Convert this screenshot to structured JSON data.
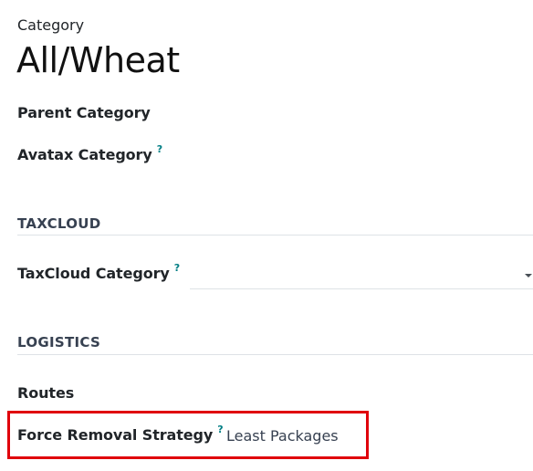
{
  "header": {
    "category_label": "Category",
    "title": "All/Wheat"
  },
  "fields": {
    "parent_category": {
      "label": "Parent Category"
    },
    "avatax_category": {
      "label": "Avatax Category",
      "help": "?"
    }
  },
  "sections": {
    "taxcloud": {
      "title": "TAXCLOUD",
      "fields": {
        "taxcloud_category": {
          "label": "TaxCloud Category",
          "help": "?",
          "value": ""
        }
      }
    },
    "logistics": {
      "title": "LOGISTICS",
      "fields": {
        "routes": {
          "label": "Routes"
        },
        "force_removal_strategy": {
          "label": "Force Removal Strategy",
          "help": "?",
          "value": "Least Packages"
        }
      }
    }
  },
  "colors": {
    "help": "#017e84",
    "highlight": "#e0000b",
    "separator": "#dee2e6"
  }
}
